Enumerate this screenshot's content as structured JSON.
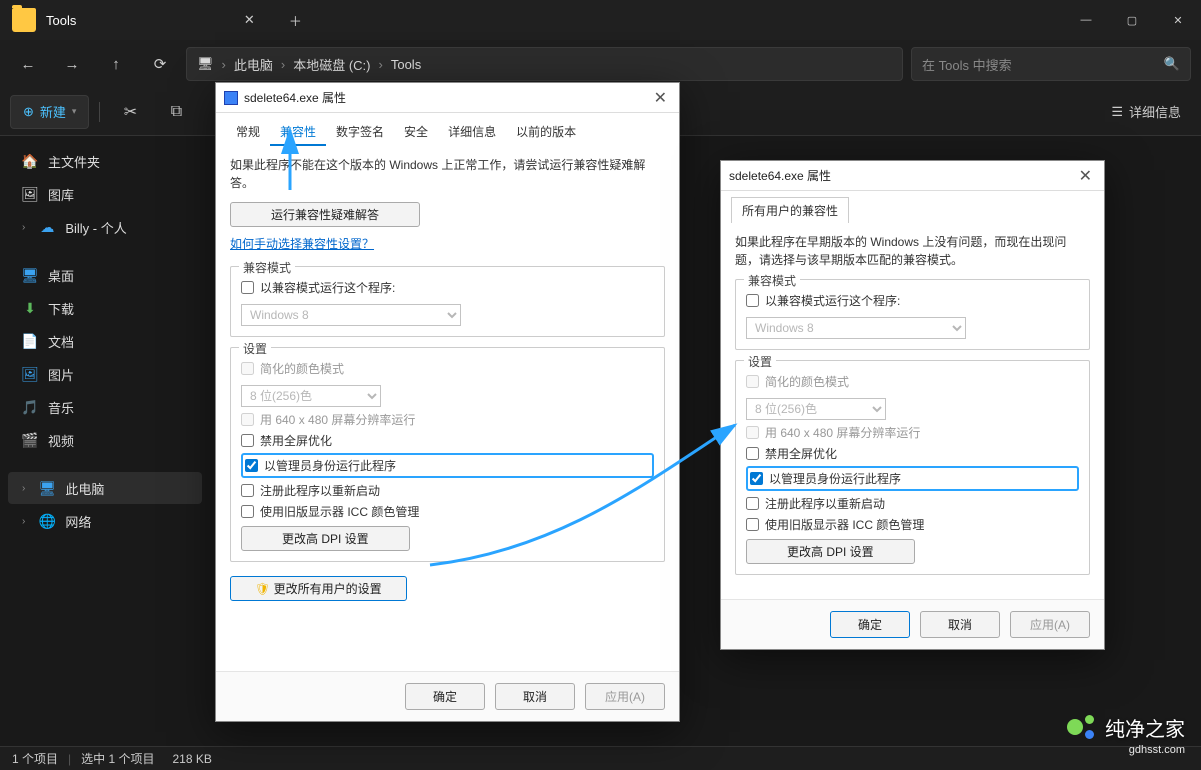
{
  "titlebar": {
    "title": "Tools"
  },
  "nav": {
    "breadcrumb": [
      "此电脑",
      "本地磁盘 (C:)",
      "Tools"
    ],
    "search_placeholder": "在 Tools 中搜索"
  },
  "cmdbar": {
    "new_label": "新建",
    "details_label": "详细信息"
  },
  "sidebar": {
    "home": "主文件夹",
    "gallery": "图库",
    "personal": "Billy - 个人",
    "desktop": "桌面",
    "downloads": "下载",
    "documents": "文档",
    "pictures": "图片",
    "music": "音乐",
    "videos": "视频",
    "thispc": "此电脑",
    "network": "网络"
  },
  "statusbar": {
    "items": "1 个项目",
    "selected": "选中 1 个项目",
    "size": "218 KB"
  },
  "dlg1": {
    "title": "sdelete64.exe 属性",
    "tabs": [
      "常规",
      "兼容性",
      "数字签名",
      "安全",
      "详细信息",
      "以前的版本"
    ],
    "active_tab": "兼容性",
    "help1": "如果此程序不能在这个版本的 Windows 上正常工作，请尝试运行兼容性疑难解答。",
    "troubleshoot_btn": "运行兼容性疑难解答",
    "help_link": "如何手动选择兼容性设置？",
    "compat_section": "兼容模式",
    "compat_chk": "以兼容模式运行这个程序:",
    "compat_os": "Windows 8",
    "settings_section": "设置",
    "reduced_color": "简化的颜色模式",
    "color_bits": "8 位(256)色",
    "res640": "用 640 x 480 屏幕分辨率运行",
    "disable_fullscreen": "禁用全屏优化",
    "run_admin": "以管理员身份运行此程序",
    "register_restart": "注册此程序以重新启动",
    "icc": "使用旧版显示器 ICC 颜色管理",
    "dpi_btn": "更改高 DPI 设置",
    "all_users_btn": "更改所有用户的设置",
    "ok": "确定",
    "cancel": "取消",
    "apply": "应用(A)"
  },
  "dlg2": {
    "title": "sdelete64.exe 属性",
    "tab": "所有用户的兼容性",
    "help1": "如果此程序在早期版本的 Windows 上没有问题，而现在出现问题，请选择与该早期版本匹配的兼容模式。",
    "compat_section": "兼容模式",
    "compat_chk": "以兼容模式运行这个程序:",
    "compat_os": "Windows 8",
    "settings_section": "设置",
    "reduced_color": "简化的颜色模式",
    "color_bits": "8 位(256)色",
    "res640": "用 640 x 480 屏幕分辨率运行",
    "disable_fullscreen": "禁用全屏优化",
    "run_admin": "以管理员身份运行此程序",
    "register_restart": "注册此程序以重新启动",
    "icc": "使用旧版显示器 ICC 颜色管理",
    "dpi_btn": "更改高 DPI 设置",
    "ok": "确定",
    "cancel": "取消",
    "apply": "应用(A)"
  },
  "watermark": {
    "brand": "纯净之家",
    "url": "gdhsst.com"
  }
}
